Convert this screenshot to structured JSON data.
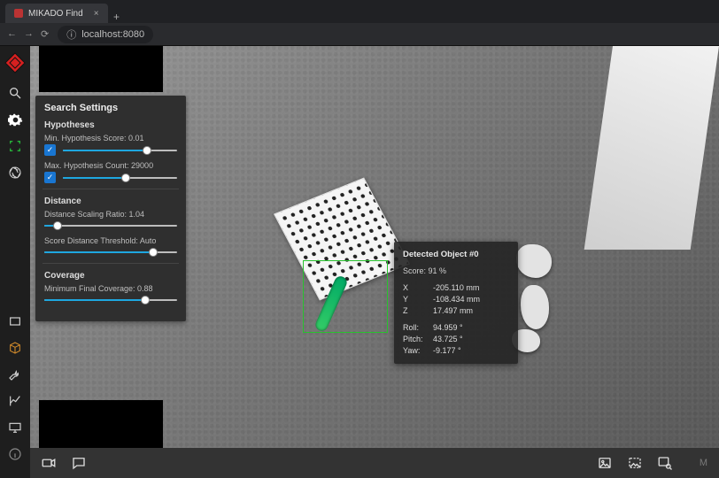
{
  "browser": {
    "tab_title": "MIKADO Find",
    "url_scheme_icon": "ⓘ",
    "url": "localhost:8080"
  },
  "panel": {
    "title": "Search Settings",
    "sections": {
      "hypotheses": {
        "heading": "Hypotheses",
        "min_score": {
          "label": "Min. Hypothesis Score: 0.01",
          "checked": true,
          "position": 0.74
        },
        "max_count": {
          "label": "Max. Hypothesis Count: 29000",
          "checked": true,
          "position": 0.55
        }
      },
      "distance": {
        "heading": "Distance",
        "scaling": {
          "label": "Distance Scaling Ratio: 1.04",
          "position": 0.1
        },
        "threshold": {
          "label": "Score Distance Threshold: Auto",
          "position": 0.82
        }
      },
      "coverage": {
        "heading": "Coverage",
        "min_final": {
          "label": "Minimum Final Coverage: 0.88",
          "position": 0.76
        }
      }
    }
  },
  "detected": {
    "title": "Detected Object #0",
    "score": "Score: 91 %",
    "pos": {
      "x": {
        "k": "X",
        "v": "-205.110 mm"
      },
      "y": {
        "k": "Y",
        "v": "-108.434 mm"
      },
      "z": {
        "k": "Z",
        "v": "17.497 mm"
      }
    },
    "rot": {
      "roll": {
        "k": "Roll:",
        "v": "94.959 °"
      },
      "pitch": {
        "k": "Pitch:",
        "v": "43.725 °"
      },
      "yaw": {
        "k": "Yaw:",
        "v": "-9.177 °"
      }
    }
  },
  "bottom": {
    "brand_fragment": "M"
  }
}
